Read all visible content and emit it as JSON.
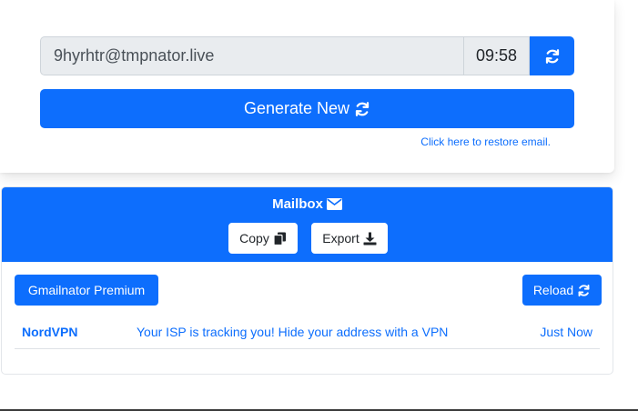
{
  "generator": {
    "email": "9hyrhtr@tmpnator.live",
    "timer": "09:58",
    "generate_label": "Generate New",
    "restore_link": "Click here to restore email."
  },
  "mailbox": {
    "title": "Mailbox",
    "copy_label": "Copy",
    "export_label": "Export",
    "premium_label": "Gmailnator Premium",
    "reload_label": "Reload",
    "messages": [
      {
        "from": "NordVPN",
        "subject": "Your ISP is tracking you! Hide your address with a VPN",
        "time": "Just Now"
      }
    ]
  },
  "icons": {
    "refresh": "refresh-icon",
    "envelope": "envelope-icon",
    "copy": "copy-icon",
    "download": "download-icon"
  },
  "colors": {
    "primary": "#0d6efd",
    "input_bg": "#e9ecef"
  }
}
